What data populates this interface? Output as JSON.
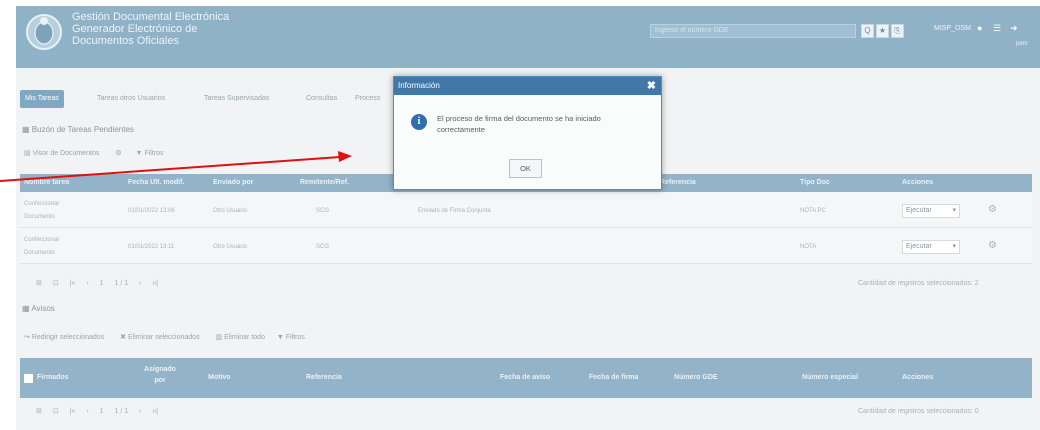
{
  "header": {
    "title_lines": [
      "Gestión Documental Electrónica",
      "Generador Electrónico de",
      "Documentos Oficiales"
    ],
    "search_placeholder": "Ingrese el número GDE",
    "buttons": [
      "Q",
      "★",
      "⎘"
    ],
    "user": "MISP_OSM",
    "subtext": "pem"
  },
  "tabs": [
    "Mis Tareas",
    "Tareas otros Usuarios",
    "Tareas Supervisadas",
    "Consultas",
    "Process"
  ],
  "pending": {
    "section_title": "Buzón de Tareas Pendientes",
    "toolbar": [
      "Visor de Documentos",
      "⚙",
      "Filtros"
    ],
    "columns": [
      "Nombre tarea",
      "Fecha Ult. modif.",
      "Enviado por",
      "Remitente/Ref.",
      "Referencia",
      "Tipo Doc",
      "Acciones"
    ],
    "rows": [
      {
        "name": [
          "Confeccionar",
          "Documento"
        ],
        "date": "01/01/2022 13:06",
        "from": "Otro Usuario",
        "ref": "SCG",
        "desc": "Enviado de Firma Conjunta",
        "type": "NOTA PC",
        "action": "Ejecutar"
      },
      {
        "name": [
          "Confeccionar",
          "Documento"
        ],
        "date": "01/01/2022 13:11",
        "from": "Otro Usuario",
        "ref": "SCG",
        "desc": "",
        "type": "NOTA",
        "action": "Ejecutar"
      }
    ],
    "pager": [
      "⊞",
      "⊡",
      "|«",
      "‹",
      "1",
      "1 / 1",
      "›",
      "»|"
    ],
    "count": "Cantidad de registros seleccionados: 2"
  },
  "avisos": {
    "section_title": "Avisos",
    "toolbar": [
      "Redirigir seleccionados",
      "Eliminar seleccionados",
      "Eliminar todo",
      "Filtros"
    ],
    "columns": [
      "Firmados",
      "Asignado por",
      "Motivo",
      "Referencia",
      "Fecha de aviso",
      "Fecha de firma",
      "Número GDE",
      "Número especial",
      "Acciones"
    ],
    "pager": [
      "⊞",
      "⊡",
      "|«",
      "‹",
      "1",
      "1 / 1",
      "›",
      "»|"
    ],
    "count": "Cantidad de registros seleccionados: 0"
  },
  "dialog": {
    "title": "Información",
    "message": "El proceso de firma del documento se ha iniciado correctamente",
    "ok": "OK"
  },
  "colors": {
    "header": "#8fb2c7",
    "dialog_title": "#3f78a9",
    "arrow": "#e01010"
  }
}
